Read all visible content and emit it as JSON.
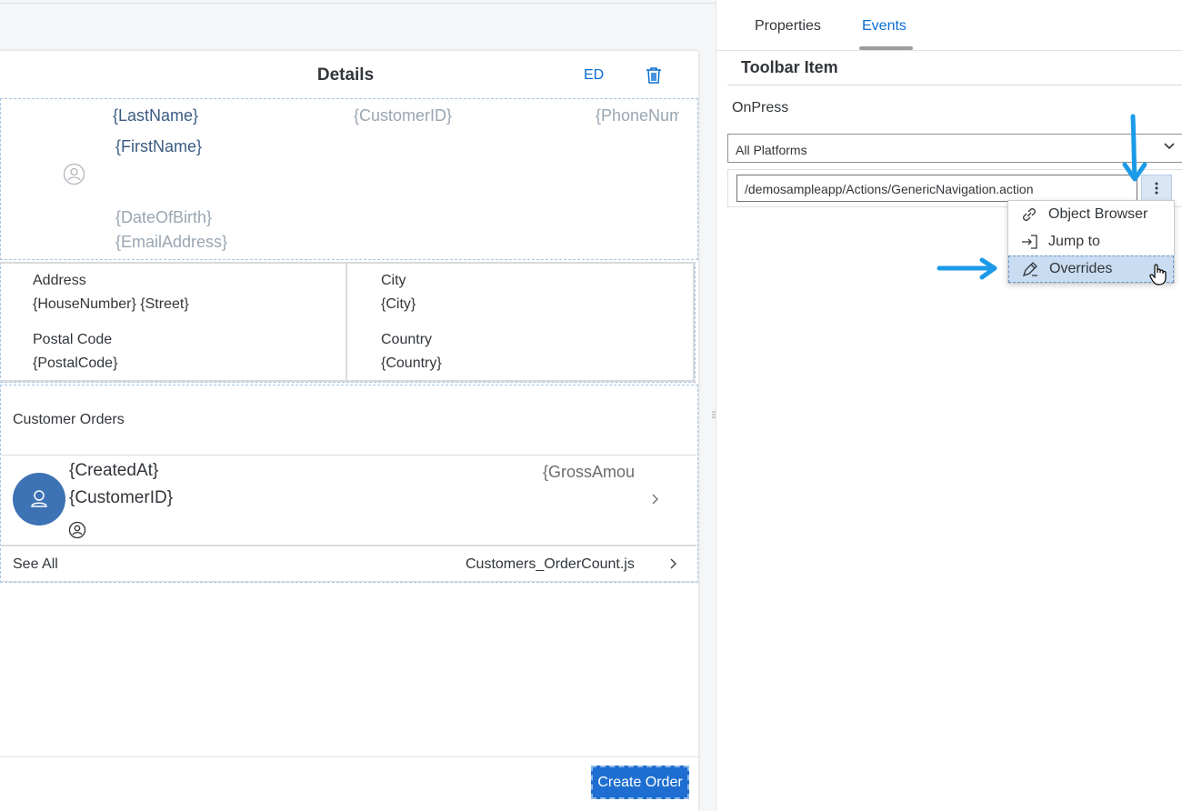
{
  "canvas": {
    "nav": {
      "title": "Details",
      "edit_label": "ED"
    },
    "header": {
      "last_name": "{LastName}",
      "first_name": "{FirstName}",
      "customer_id": "{CustomerID}",
      "phone": "{PhoneNumber}",
      "dob": "{DateOfBirth}",
      "email": "{EmailAddress}"
    },
    "key_values": [
      {
        "label": "Address",
        "value": "{HouseNumber} {Street}"
      },
      {
        "label": "City",
        "value": "{City}"
      },
      {
        "label": "Postal Code",
        "value": "{PostalCode}"
      },
      {
        "label": "Country",
        "value": "{Country}"
      }
    ],
    "orders": {
      "title": "Customer Orders",
      "item": {
        "title": "{CreatedAt}",
        "subtitle": "{CustomerID}",
        "status": "{GrossAmount}"
      },
      "see_all": "See All",
      "see_all_value": "Customers_OrderCount.js"
    },
    "create_button": "Create Order"
  },
  "panel": {
    "tabs": [
      {
        "label": "Properties",
        "active": false
      },
      {
        "label": "Events",
        "active": true
      }
    ],
    "section_title": "Toolbar Item",
    "event_label": "OnPress",
    "platform_selected": "All Platforms",
    "action_path": "/demosampleapp/Actions/GenericNavigation.action",
    "menu": [
      {
        "label": "Object Browser",
        "icon": "link-icon"
      },
      {
        "label": "Jump to",
        "icon": "jump-to-icon"
      },
      {
        "label": "Overrides",
        "icon": "overrides-icon",
        "highlighted": true
      }
    ]
  },
  "colors": {
    "accent": "#0a6ed1",
    "button_bg": "#1d6ed0",
    "avatar_bg": "#3d72b4",
    "annotation_arrow": "#1b9ae8",
    "menu_highlight": "#c9dcf1"
  }
}
